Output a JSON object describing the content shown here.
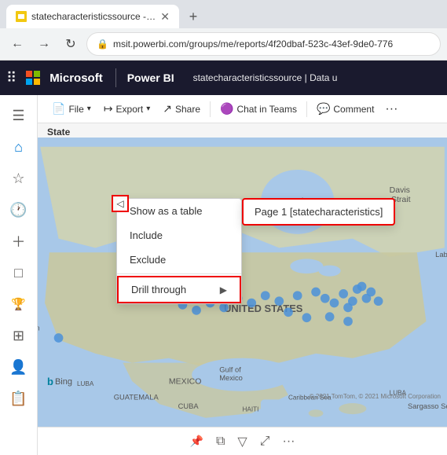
{
  "browser": {
    "tab_label": "statecharacteristicssource - Powe",
    "address": "msit.powerbi.com/groups/me/reports/4f20dbaf-523c-43ef-9de0-776",
    "nav_back": "←",
    "nav_forward": "→",
    "nav_refresh": "↻",
    "new_tab": "+"
  },
  "app": {
    "waffle": "⊞",
    "brand": "Power BI",
    "title": "statecharacteristicssource  |  Data u",
    "ms_label": "Microsoft"
  },
  "report_toolbar": {
    "file_label": "File",
    "export_label": "Export",
    "share_label": "Share",
    "chat_label": "Chat in Teams",
    "comment_label": "Comment",
    "more": "···"
  },
  "map": {
    "state_label": "State",
    "bing_label": "Bing"
  },
  "context_menu": {
    "show_table": "Show as a table",
    "include": "Include",
    "exclude": "Exclude",
    "drill_through": "Drill through"
  },
  "drill_submenu": {
    "item1": "Page 1 [statecharacteristics]"
  },
  "bottom_toolbar": {
    "pin": "📌",
    "copy": "⧉",
    "filter": "▽",
    "expand": "⤢",
    "more": "···"
  },
  "sidebar": {
    "icons": [
      "☰",
      "⌂",
      "★",
      "🕐",
      "+",
      "□",
      "🏆",
      "⊞",
      "👤",
      "📋"
    ]
  }
}
